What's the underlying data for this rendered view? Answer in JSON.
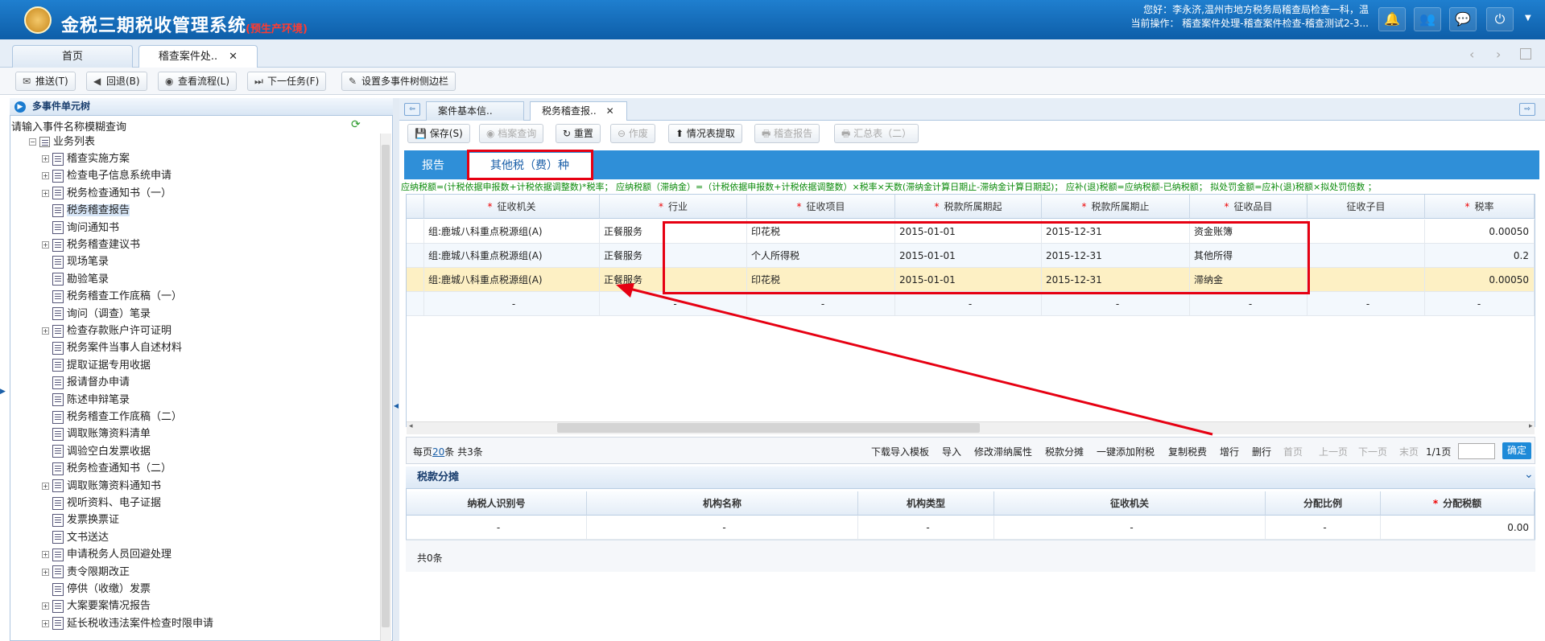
{
  "app": {
    "title": "金税三期税收管理系统",
    "env_tag": "(预生产环境)"
  },
  "user": {
    "greeting": "您好：李永济,温州市地方税务局稽查局检查一科，温",
    "current_op": "当前操作： 稽查案件处理-稽查案件检查-稽查测试2-3..."
  },
  "page_tabs": [
    {
      "label": "首页"
    },
    {
      "label": "稽查案件处..",
      "close": "✕"
    }
  ],
  "toolbar": [
    {
      "label": "推送(T)",
      "icon": "mail-icon"
    },
    {
      "label": "回退(B)",
      "icon": "back-icon"
    },
    {
      "label": "查看流程(L)",
      "icon": "eye-icon"
    },
    {
      "label": "下一任务(F)",
      "icon": "next-icon"
    },
    {
      "label": "设置多事件树侧边栏",
      "icon": "edit-icon"
    }
  ],
  "tree": {
    "header": "多事件单元树",
    "search_label": "请输入事件名称模糊查询",
    "root": "业务列表",
    "items": [
      {
        "label": "稽查实施方案",
        "exp": true
      },
      {
        "label": "检查电子信息系统申请",
        "exp": true
      },
      {
        "label": "税务检查通知书（一）",
        "exp": true
      },
      {
        "label": "税务稽查报告",
        "exp": false,
        "selected": true
      },
      {
        "label": "询问通知书",
        "exp": false
      },
      {
        "label": "税务稽查建议书",
        "exp": true
      },
      {
        "label": "现场笔录",
        "exp": false
      },
      {
        "label": "勘验笔录",
        "exp": false
      },
      {
        "label": "税务稽查工作底稿（一）",
        "exp": false
      },
      {
        "label": "询问（调查）笔录",
        "exp": false
      },
      {
        "label": "检查存款账户许可证明",
        "exp": true
      },
      {
        "label": "税务案件当事人自述材料",
        "exp": false
      },
      {
        "label": "提取证据专用收据",
        "exp": false
      },
      {
        "label": "报请督办申请",
        "exp": false
      },
      {
        "label": "陈述申辩笔录",
        "exp": false
      },
      {
        "label": "税务稽查工作底稿（二）",
        "exp": false
      },
      {
        "label": "调取账簿资料清单",
        "exp": false
      },
      {
        "label": "调验空白发票收据",
        "exp": false
      },
      {
        "label": "税务检查通知书（二）",
        "exp": false
      },
      {
        "label": "调取账簿资料通知书",
        "exp": true
      },
      {
        "label": "视听资料、电子证据",
        "exp": false
      },
      {
        "label": "发票换票证",
        "exp": false
      },
      {
        "label": "文书送达",
        "exp": false
      },
      {
        "label": "申请税务人员回避处理",
        "exp": true
      },
      {
        "label": "责令限期改正",
        "exp": true
      },
      {
        "label": "停供（收缴）发票",
        "exp": false
      },
      {
        "label": "大案要案情况报告",
        "exp": true
      },
      {
        "label": "延长税收违法案件检查时限申请",
        "exp": true
      }
    ]
  },
  "inner_tabs": [
    {
      "label": "案件基本信.."
    },
    {
      "label": "税务稽查报..",
      "close": "✕"
    }
  ],
  "sub_toolbar": [
    {
      "label": "保存(S)",
      "disabled": false
    },
    {
      "label": "档案查询",
      "disabled": true
    },
    {
      "label": "重置",
      "disabled": false
    },
    {
      "label": "作废",
      "disabled": true
    },
    {
      "label": "情况表提取",
      "disabled": false
    },
    {
      "label": "稽查报告",
      "disabled": true
    },
    {
      "label": "汇总表（二）",
      "disabled": true
    }
  ],
  "report_tabs": [
    {
      "label": "报告"
    },
    {
      "label": "其他税（费）种"
    }
  ],
  "formula": "应纳税额=(计税依据申报数+计税依据调整数)*税率； 应纳税额（滞纳金）=（计税依据申报数+计税依据调整数）×税率×天数(滞纳金计算日期止-滞纳金计算日期起)； 应补(退)税额=应纳税额-已纳税额； 拟处罚金额=应补(退)税额×拟处罚倍数 ；",
  "grid": {
    "columns": [
      {
        "label": "征收机关",
        "req": true
      },
      {
        "label": "行业",
        "req": true
      },
      {
        "label": "征收项目",
        "req": true
      },
      {
        "label": "税款所属期起",
        "req": true
      },
      {
        "label": "税款所属期止",
        "req": true
      },
      {
        "label": "征收品目",
        "req": true
      },
      {
        "label": "征收子目",
        "req": false
      },
      {
        "label": "税率",
        "req": true
      }
    ],
    "rows": [
      [
        "组:鹿城八科重点税源组(A)",
        "正餐服务",
        "印花税",
        "2015-01-01",
        "2015-12-31",
        "资金账簿",
        "",
        "0.00050"
      ],
      [
        "组:鹿城八科重点税源组(A)",
        "正餐服务",
        "个人所得税",
        "2015-01-01",
        "2015-12-31",
        "其他所得",
        "",
        "0.2"
      ],
      [
        "组:鹿城八科重点税源组(A)",
        "正餐服务",
        "印花税",
        "2015-01-01",
        "2015-12-31",
        "滞纳金",
        "",
        "0.00050"
      ],
      [
        "-",
        "-",
        "-",
        "-",
        "-",
        "-",
        "-",
        "-"
      ]
    ]
  },
  "pager": {
    "per_page_prefix": "每页",
    "per_page": "20",
    "total": "条 共3条",
    "actions": [
      "下载导入模板",
      "导入",
      "修改滞纳属性",
      "税款分摊",
      "一键添加附税",
      "复制税费",
      "增行",
      "删行"
    ],
    "nav": [
      "首页",
      "上一页",
      "下一页",
      "末页"
    ],
    "page_info": "1/1页",
    "go": "确定"
  },
  "alloc": {
    "title": "税款分摊",
    "columns": [
      {
        "label": "纳税人识别号",
        "req": false
      },
      {
        "label": "机构名称",
        "req": false
      },
      {
        "label": "机构类型",
        "req": false
      },
      {
        "label": "征收机关",
        "req": false
      },
      {
        "label": "分配比例",
        "req": false
      },
      {
        "label": "分配税额",
        "req": true
      }
    ],
    "row": [
      "-",
      "-",
      "-",
      "-",
      "-",
      "0.00"
    ],
    "total": "共0条"
  },
  "colors": {
    "header": "#1573c4",
    "accent": "#2f8fd8",
    "highlight_row": "#fdf0c4",
    "annotation": "#e60012"
  }
}
